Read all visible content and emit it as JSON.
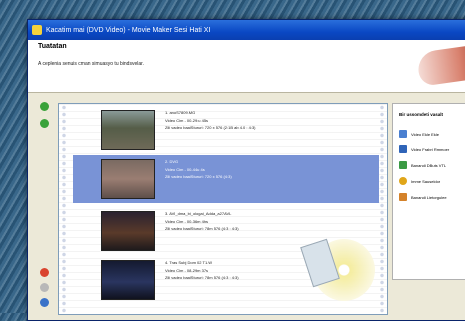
{
  "window": {
    "title": "Kacatim mai (DVD Video) - Movie Maker Sesi Hati XI"
  },
  "header": {
    "title": "Tuatatan",
    "subtitle": "A ceplenia senuis cman simuasyo tu bindsvelar."
  },
  "clips": [
    {
      "line1": "1. anoS7809.MG",
      "line2": "Video Cim - 00-29:u 45s",
      "line3": "Zili vadeo baalStururi: 720 x 576 (2:1B ab 4.0 : 4:3)",
      "selected": false
    },
    {
      "line1": "2. DVG",
      "line2": "Video Cim - 00-44u 4s",
      "line3": "Zili vadeo baalStururi: 720 x 576 (4:3)",
      "selected": true
    },
    {
      "line1": "3. AVI_dma_bi_ologai_Adda_a27AVL",
      "line2": "Video Cim - 00-36m 4hs",
      "line3": "Zili vadeo baalStururi: 78m 576 (4:3 : 4:3)",
      "selected": false
    },
    {
      "line1": "4. Tras Subj Dom 02 T1.W",
      "line2": "Video Cim - 08-29m 37s",
      "line3": "Zili vadeo baalStururi: 78m 576 (4:3 : 4:3)",
      "selected": false
    }
  ],
  "tasks": {
    "title": "Bir ussomdeti vasalt",
    "items": [
      {
        "label": "Video Ekle Ekle",
        "color": "#4a7fd0"
      },
      {
        "label": "Video Frabri Rmmoer",
        "color": "#2f64b8"
      },
      {
        "label": "Banandi DButs VTL",
        "color": "#3a9a44"
      },
      {
        "label": "Imme Sauseldor",
        "color": "#e0a61a"
      },
      {
        "label": "Banandi Lietorgulee",
        "color": "#d4822a"
      }
    ]
  },
  "side_buttons": [
    {
      "name": "move-up-icon",
      "color": "#3aa23a"
    },
    {
      "name": "move-down-icon",
      "color": "#3aa23a"
    },
    {
      "name": "remove-icon",
      "color": "#d9442e"
    },
    {
      "name": "properties-icon",
      "color": "#b8b8b8"
    },
    {
      "name": "help-icon",
      "color": "#3a72c8"
    }
  ]
}
